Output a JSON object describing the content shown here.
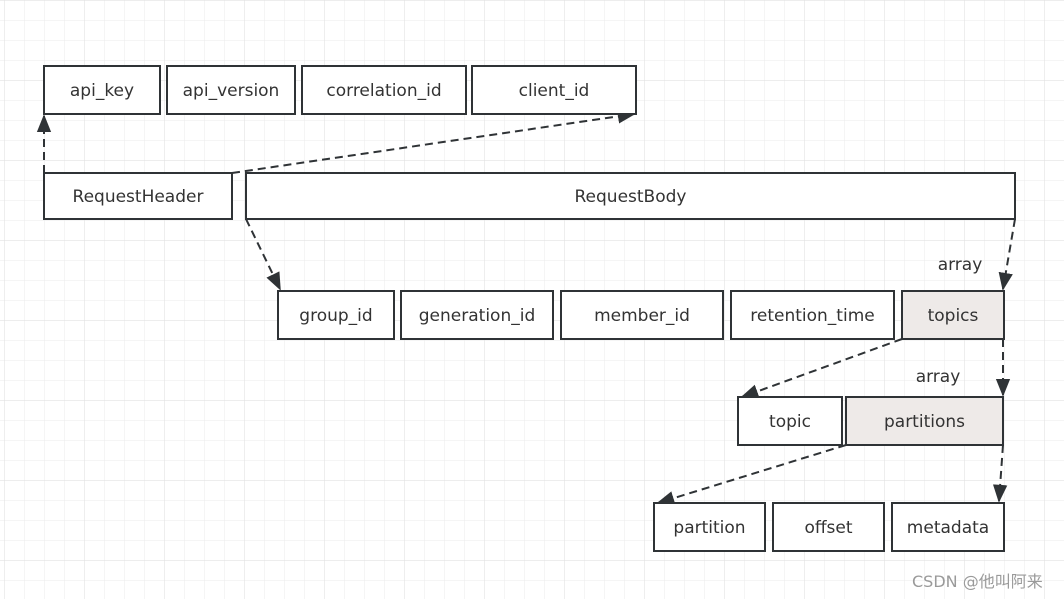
{
  "colors": {
    "stroke": "#2f3336",
    "highlight_fill": "#eeeae8",
    "grid": "#ebebeb",
    "text": "#333333"
  },
  "boxes": [
    {
      "id": "api_key",
      "label": "api_key"
    },
    {
      "id": "api_version",
      "label": "api_version"
    },
    {
      "id": "correlation_id",
      "label": "correlation_id"
    },
    {
      "id": "client_id",
      "label": "client_id"
    },
    {
      "id": "request_header",
      "label": "RequestHeader"
    },
    {
      "id": "request_body",
      "label": "RequestBody"
    },
    {
      "id": "group_id",
      "label": "group_id"
    },
    {
      "id": "generation_id",
      "label": "generation_id"
    },
    {
      "id": "member_id",
      "label": "member_id"
    },
    {
      "id": "retention_time",
      "label": "retention_time"
    },
    {
      "id": "topics",
      "label": "topics",
      "highlight": true
    },
    {
      "id": "topic",
      "label": "topic"
    },
    {
      "id": "partitions",
      "label": "partitions",
      "highlight": true
    },
    {
      "id": "partition",
      "label": "partition"
    },
    {
      "id": "offset",
      "label": "offset"
    },
    {
      "id": "metadata",
      "label": "metadata"
    }
  ],
  "edges": [
    {
      "from": "request_header",
      "to": "api_key"
    },
    {
      "from": "request_header",
      "to": "client_id"
    },
    {
      "from": "request_body",
      "to": "group_id"
    },
    {
      "from": "request_body",
      "to": "topics",
      "label": "array"
    },
    {
      "from": "topics",
      "to": "topic"
    },
    {
      "from": "topics",
      "to": "partitions",
      "label": "array"
    },
    {
      "from": "partitions",
      "to": "partition"
    },
    {
      "from": "partitions",
      "to": "metadata"
    }
  ],
  "watermark": "CSDN @他叫阿来"
}
